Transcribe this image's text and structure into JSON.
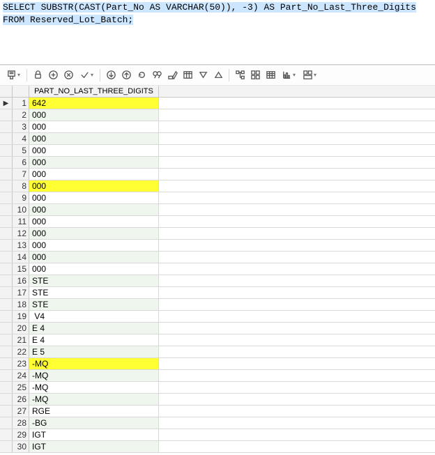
{
  "sql": {
    "line1": "SELECT SUBSTR(CAST(Part_No AS VARCHAR(50)), -3) AS Part_No_Last_Three_Digits",
    "line2": "FROM Reserved_Lot_Batch;"
  },
  "toolbar": {
    "icons": [
      "pin-dropdown",
      "sep",
      "lock",
      "add-circle",
      "remove-circle",
      "check-dropdown",
      "sep",
      "download-circle",
      "upload-circle",
      "refresh-circle",
      "binoculars",
      "edit-table",
      "grid-columns",
      "filter-down",
      "filter-up",
      "sep",
      "tree-view",
      "tiles-view",
      "grid-view",
      "chart-dropdown",
      "layout-dropdown"
    ]
  },
  "grid": {
    "column_header": "PART_NO_LAST_THREE_DIGITS",
    "rows": [
      {
        "n": 1,
        "v": "642",
        "hl": true,
        "cur": true
      },
      {
        "n": 2,
        "v": "000"
      },
      {
        "n": 3,
        "v": "000"
      },
      {
        "n": 4,
        "v": "000"
      },
      {
        "n": 5,
        "v": "000"
      },
      {
        "n": 6,
        "v": "000"
      },
      {
        "n": 7,
        "v": "000"
      },
      {
        "n": 8,
        "v": "000",
        "hl": true
      },
      {
        "n": 9,
        "v": "000"
      },
      {
        "n": 10,
        "v": "000"
      },
      {
        "n": 11,
        "v": "000"
      },
      {
        "n": 12,
        "v": "000"
      },
      {
        "n": 13,
        "v": "000"
      },
      {
        "n": 14,
        "v": "000"
      },
      {
        "n": 15,
        "v": "000"
      },
      {
        "n": 16,
        "v": "STE"
      },
      {
        "n": 17,
        "v": "STE"
      },
      {
        "n": 18,
        "v": "STE"
      },
      {
        "n": 19,
        "v": " V4"
      },
      {
        "n": 20,
        "v": "E 4"
      },
      {
        "n": 21,
        "v": "E 4"
      },
      {
        "n": 22,
        "v": "E 5"
      },
      {
        "n": 23,
        "v": "-MQ",
        "hl": true
      },
      {
        "n": 24,
        "v": "-MQ"
      },
      {
        "n": 25,
        "v": "-MQ"
      },
      {
        "n": 26,
        "v": "-MQ"
      },
      {
        "n": 27,
        "v": "RGE"
      },
      {
        "n": 28,
        "v": "-BG"
      },
      {
        "n": 29,
        "v": "IGT"
      },
      {
        "n": 30,
        "v": "IGT"
      }
    ]
  }
}
